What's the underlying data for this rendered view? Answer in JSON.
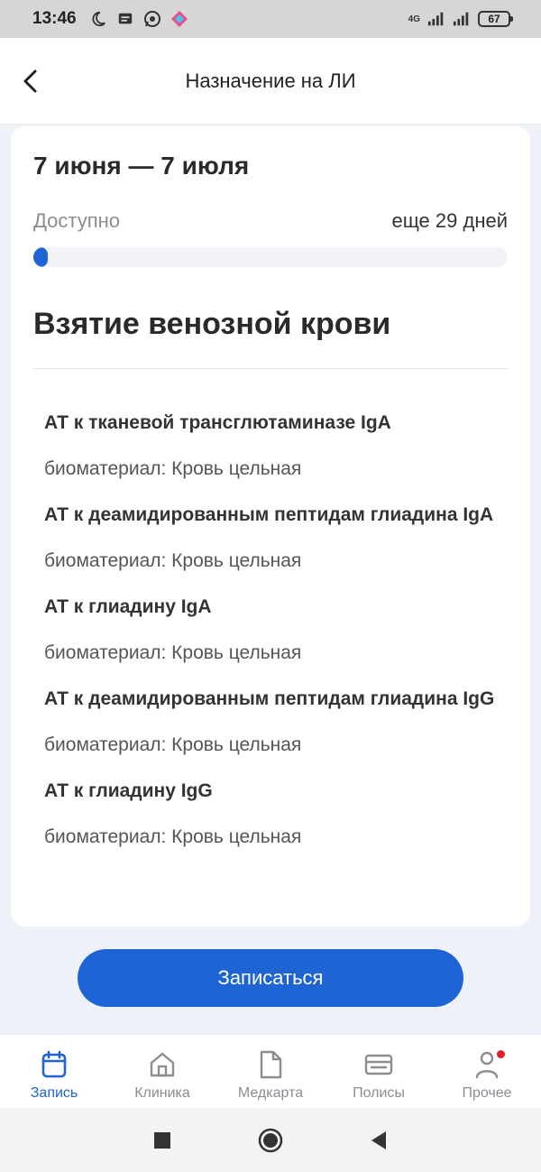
{
  "status_bar": {
    "time": "13:46",
    "network": "4G",
    "battery": "67"
  },
  "header": {
    "title": "Назначение на ЛИ"
  },
  "card": {
    "date_range": "7 июня — 7 июля",
    "available_label": "Доступно",
    "remaining": "еще 29 дней",
    "progress_fraction": 0.03,
    "section_title": "Взятие венозной крови",
    "tests": [
      {
        "name": "АТ к тканевой трансглютаминазе IgA",
        "biomaterial": "биоматериал: Кровь цельная"
      },
      {
        "name": "АТ к деамидированным пептидам глиадина IgA",
        "biomaterial": "биоматериал: Кровь цельная"
      },
      {
        "name": "АТ к глиадину IgA",
        "biomaterial": "биоматериал: Кровь цельная"
      },
      {
        "name": "АТ к деамидированным пептидам глиадина IgG",
        "biomaterial": "биоматериал: Кровь цельная"
      },
      {
        "name": "АТ к глиадину IgG",
        "biomaterial": "биоматериал: Кровь цельная"
      }
    ]
  },
  "book_button": {
    "label": "Записаться"
  },
  "bottom_nav": {
    "items": [
      {
        "label": "Запись",
        "icon": "calendar-icon",
        "active": true
      },
      {
        "label": "Клиника",
        "icon": "home-icon",
        "active": false
      },
      {
        "label": "Медкарта",
        "icon": "document-icon",
        "active": false
      },
      {
        "label": "Полисы",
        "icon": "card-icon",
        "active": false
      },
      {
        "label": "Прочее",
        "icon": "person-icon",
        "active": false
      }
    ]
  },
  "colors": {
    "accent": "#1f64d4",
    "background": "#eef1f8",
    "notification": "#e01f2a"
  }
}
